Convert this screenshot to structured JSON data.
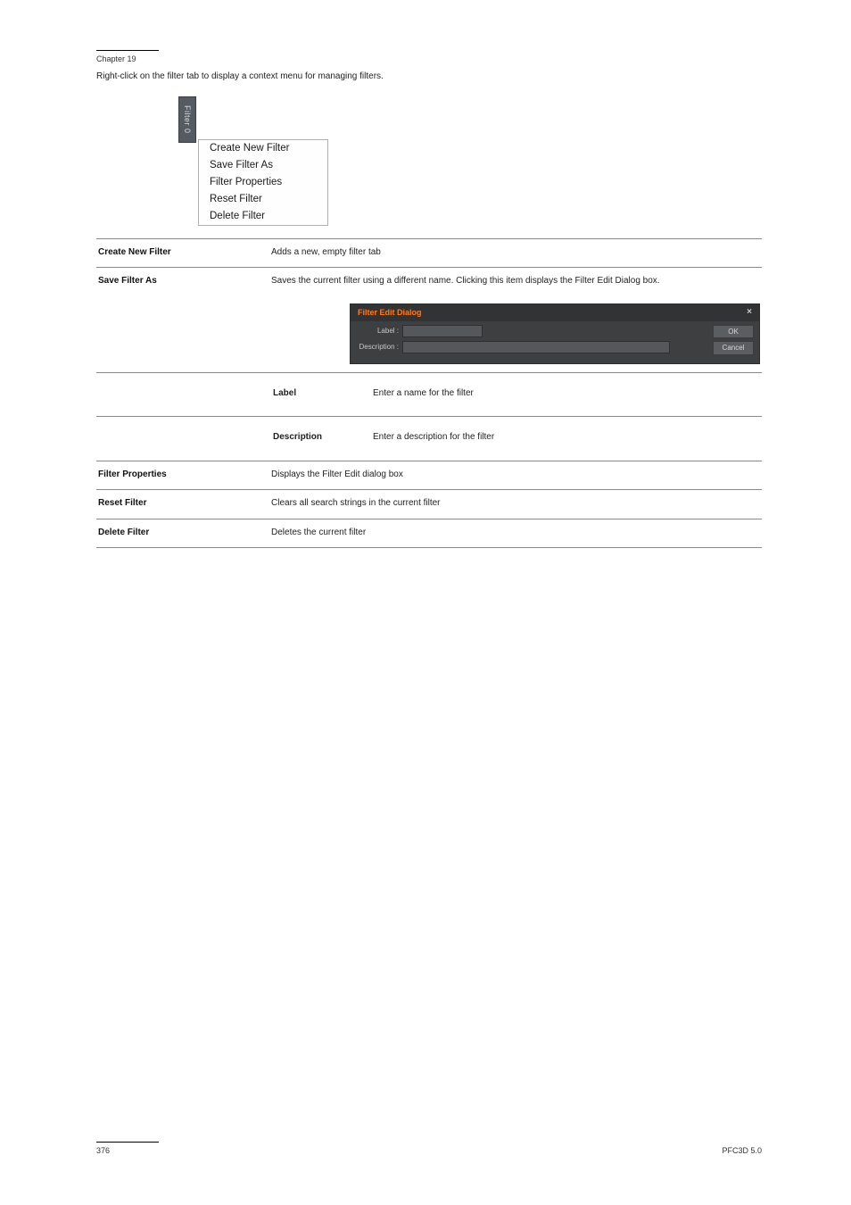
{
  "header": {
    "small": "Chapter 19"
  },
  "intro": "Right-click on the filter tab to display a context menu for managing filters.",
  "screenshot1": {
    "tab_label": "Filter 0",
    "menu_items": [
      "Create New Filter",
      "Save Filter As",
      "Filter Properties",
      "Reset Filter",
      "Delete Filter"
    ]
  },
  "defs": [
    {
      "term": "Create New Filter",
      "desc": "Adds a new, empty filter tab"
    },
    {
      "term": "Save Filter As",
      "desc": "Saves the current filter using a different name. Clicking this item displays the Filter Edit Dialog box."
    }
  ],
  "dialog": {
    "title": "Filter Edit Dialog",
    "label_label": "Label :",
    "desc_label": "Description :",
    "ok": "OK",
    "cancel": "Cancel"
  },
  "dialog_rows": [
    {
      "term": "Label",
      "desc": "Enter a name for the filter"
    },
    {
      "term": "Description",
      "desc": "Enter a description for the filter"
    }
  ],
  "defs2": [
    {
      "term": "Filter Properties",
      "desc": "Displays the Filter Edit dialog box"
    },
    {
      "term": "Reset Filter",
      "desc": "Clears all search strings in the current filter"
    },
    {
      "term": "Delete Filter",
      "desc": "Deletes the current filter"
    }
  ],
  "footer": {
    "left": "376",
    "right": "PFC3D 5.0"
  }
}
